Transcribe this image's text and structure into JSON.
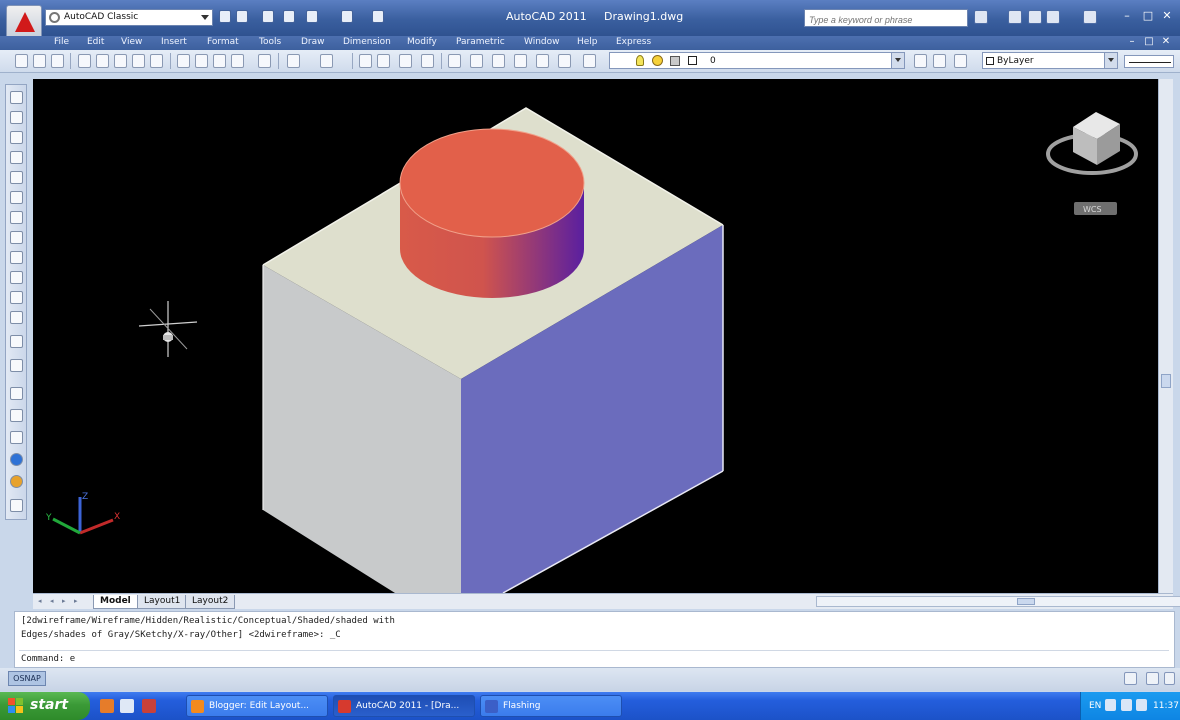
{
  "titlebar": {
    "workspace": "AutoCAD Classic",
    "app_title": "AutoCAD 2011",
    "doc_title": "Drawing1.dwg",
    "search_placeholder": "Type a keyword or phrase",
    "min": "–",
    "max": "□",
    "close": "✕"
  },
  "menu": {
    "items": [
      "File",
      "Edit",
      "View",
      "Insert",
      "Format",
      "Tools",
      "Draw",
      "Dimension",
      "Modify",
      "Parametric",
      "Window",
      "Help",
      "Express"
    ],
    "doc_min": "–",
    "doc_max": "□",
    "doc_close": "✕"
  },
  "layers": {
    "current_layer": "0",
    "color_value": "ByLayer"
  },
  "viewport": {
    "viewcube_label": "WCS",
    "ucs_x": "X",
    "ucs_y": "Y",
    "ucs_z": "Z",
    "colors": {
      "top_face": "#dedfcd",
      "left_face": "#c8cacb",
      "right_face": "#6b6cbd",
      "cylinder_top": "#e2604a",
      "cylinder_side_light": "#d85a49",
      "cylinder_side_dark": "#5a1fa0"
    }
  },
  "layout_tabs": [
    "Model",
    "Layout1",
    "Layout2"
  ],
  "command": {
    "line1": "[2dwireframe/Wireframe/Hidden/Realistic/Conceptual/Shaded/shaded with",
    "line2": "Edges/shades of Gray/SKetchy/X-ray/Other] <2dwireframe>: _C",
    "prompt": "Command: e"
  },
  "status": {
    "osnap": "OSNAP"
  },
  "taskbar": {
    "start_label": "start",
    "tasks": [
      "Blogger: Edit Layout...",
      "AutoCAD 2011 - [Dra...",
      "Flashing"
    ],
    "lang": "EN",
    "clock": "11:37"
  }
}
